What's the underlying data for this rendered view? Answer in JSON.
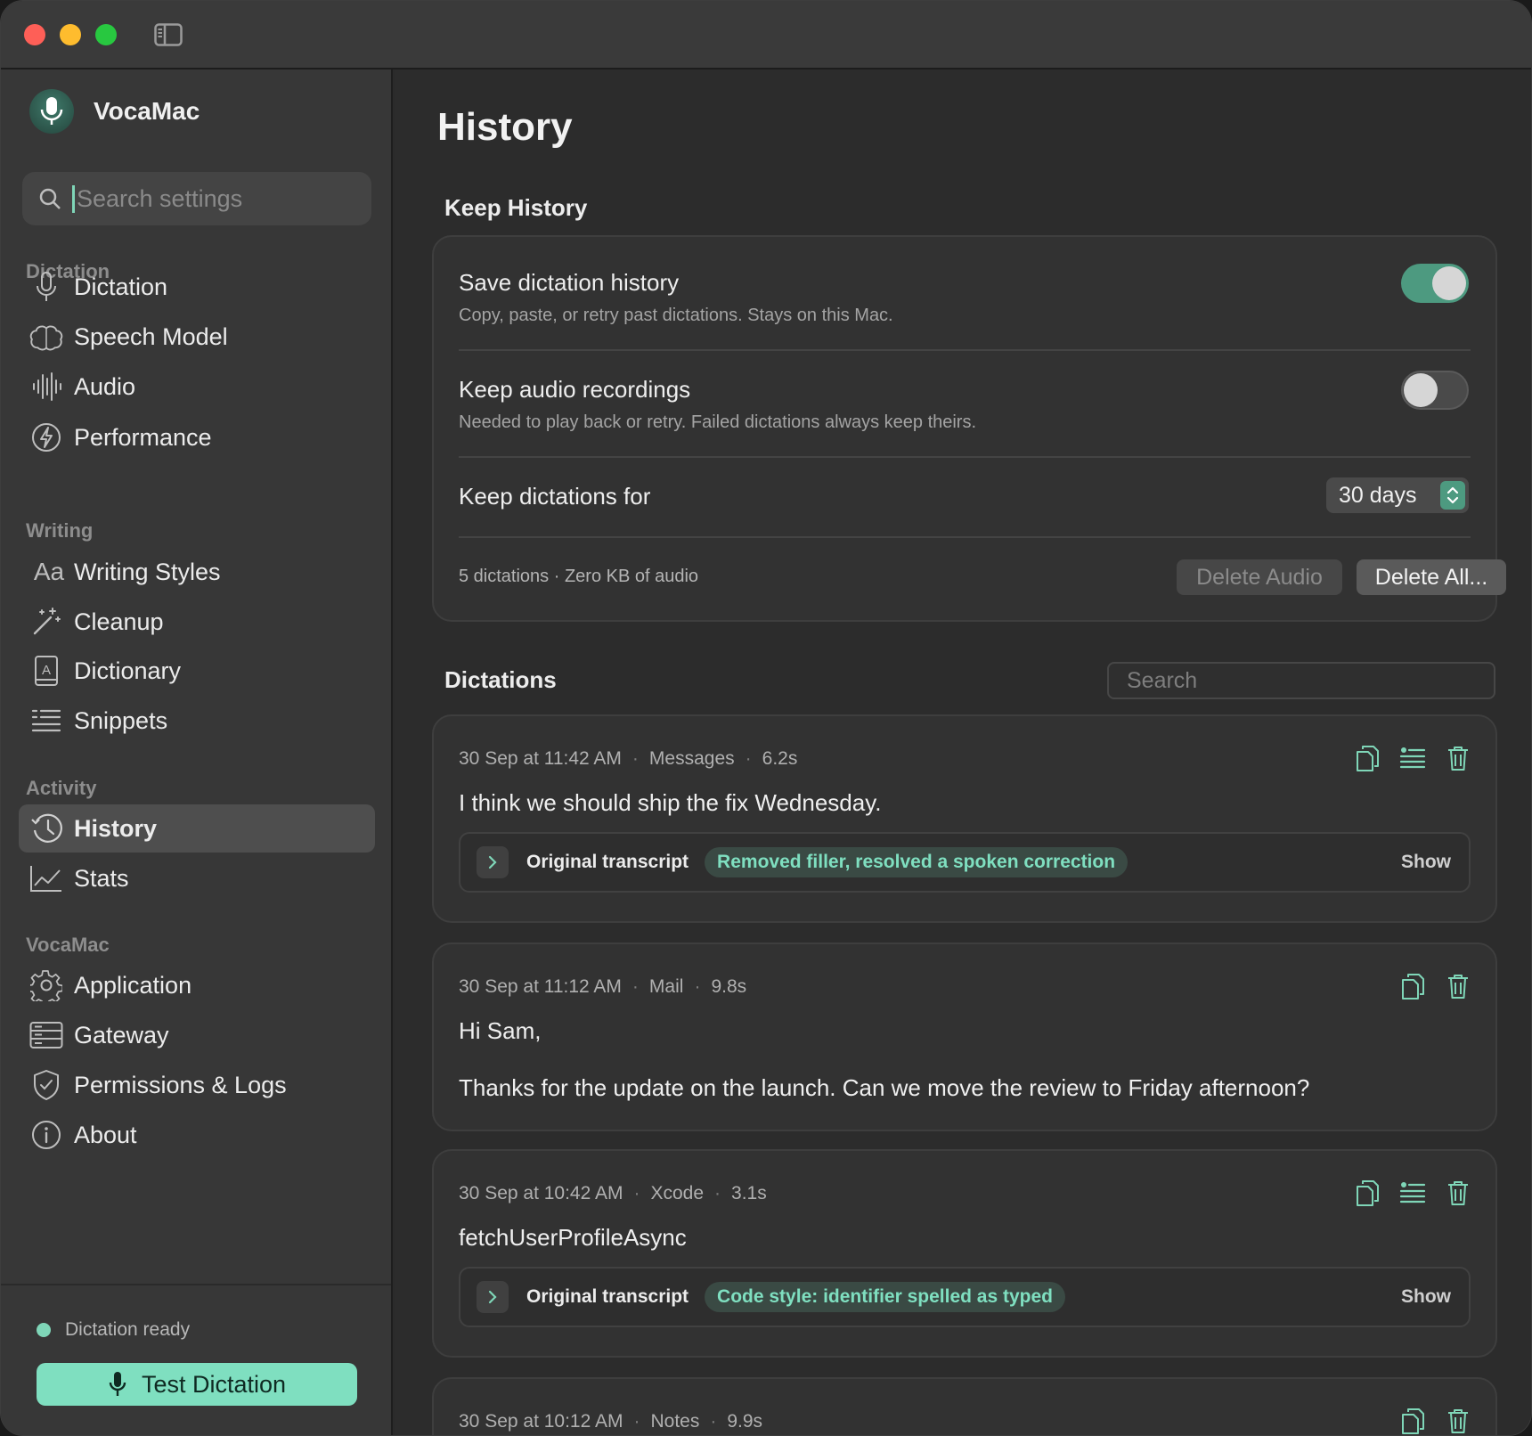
{
  "app": {
    "name": "VocaMac"
  },
  "sidebar": {
    "search_placeholder": "Search settings",
    "sections": [
      {
        "label": "Dictation",
        "items": [
          "Dictation",
          "Speech Model",
          "Audio",
          "Performance"
        ]
      },
      {
        "label": "Writing",
        "items": [
          "Writing Styles",
          "Cleanup",
          "Dictionary",
          "Snippets"
        ]
      },
      {
        "label": "Activity",
        "items": [
          "History",
          "Stats"
        ]
      },
      {
        "label": "VocaMac",
        "items": [
          "Application",
          "Gateway",
          "Permissions & Logs",
          "About"
        ]
      }
    ],
    "active_item": "History",
    "status_text": "Dictation ready",
    "test_button": "Test Dictation"
  },
  "main": {
    "title": "History",
    "keep_history": {
      "heading": "Keep History",
      "save_history": {
        "title": "Save dictation history",
        "subtitle": "Copy, paste, or retry past dictations. Stays on this Mac.",
        "enabled": true
      },
      "keep_audio": {
        "title": "Keep audio recordings",
        "subtitle": "Needed to play back or retry. Failed dictations always keep theirs.",
        "enabled": false
      },
      "keep_for": {
        "title": "Keep dictations for",
        "value": "30 days"
      },
      "summary": "5 dictations · Zero KB of audio",
      "delete_audio": "Delete Audio",
      "delete_all": "Delete All..."
    },
    "dictations": {
      "heading": "Dictations",
      "search_placeholder": "Search",
      "items": [
        {
          "time": "30 Sep at 11:42 AM",
          "app": "Messages",
          "duration": "6.2s",
          "text": "I think we should ship the fix Wednesday.",
          "transcript_label": "Original transcript",
          "badge": "Removed filler, resolved a spoken correction",
          "show": "Show"
        },
        {
          "time": "30 Sep at 11:12 AM",
          "app": "Mail",
          "duration": "9.8s",
          "line1": "Hi Sam,",
          "line2": "Thanks for the update on the launch. Can we move the review to Friday afternoon?"
        },
        {
          "time": "30 Sep at 10:42 AM",
          "app": "Xcode",
          "duration": "3.1s",
          "text": "fetchUserProfileAsync",
          "transcript_label": "Original transcript",
          "badge": "Code style: identifier spelled as typed",
          "show": "Show"
        },
        {
          "time": "30 Sep at 10:12 AM",
          "app": "Notes",
          "duration": "9.9s"
        }
      ]
    }
  },
  "colors": {
    "accent": "#7fdfc0",
    "toggle_on": "#4d9a80",
    "icon_tint": "#7fd6b8"
  }
}
